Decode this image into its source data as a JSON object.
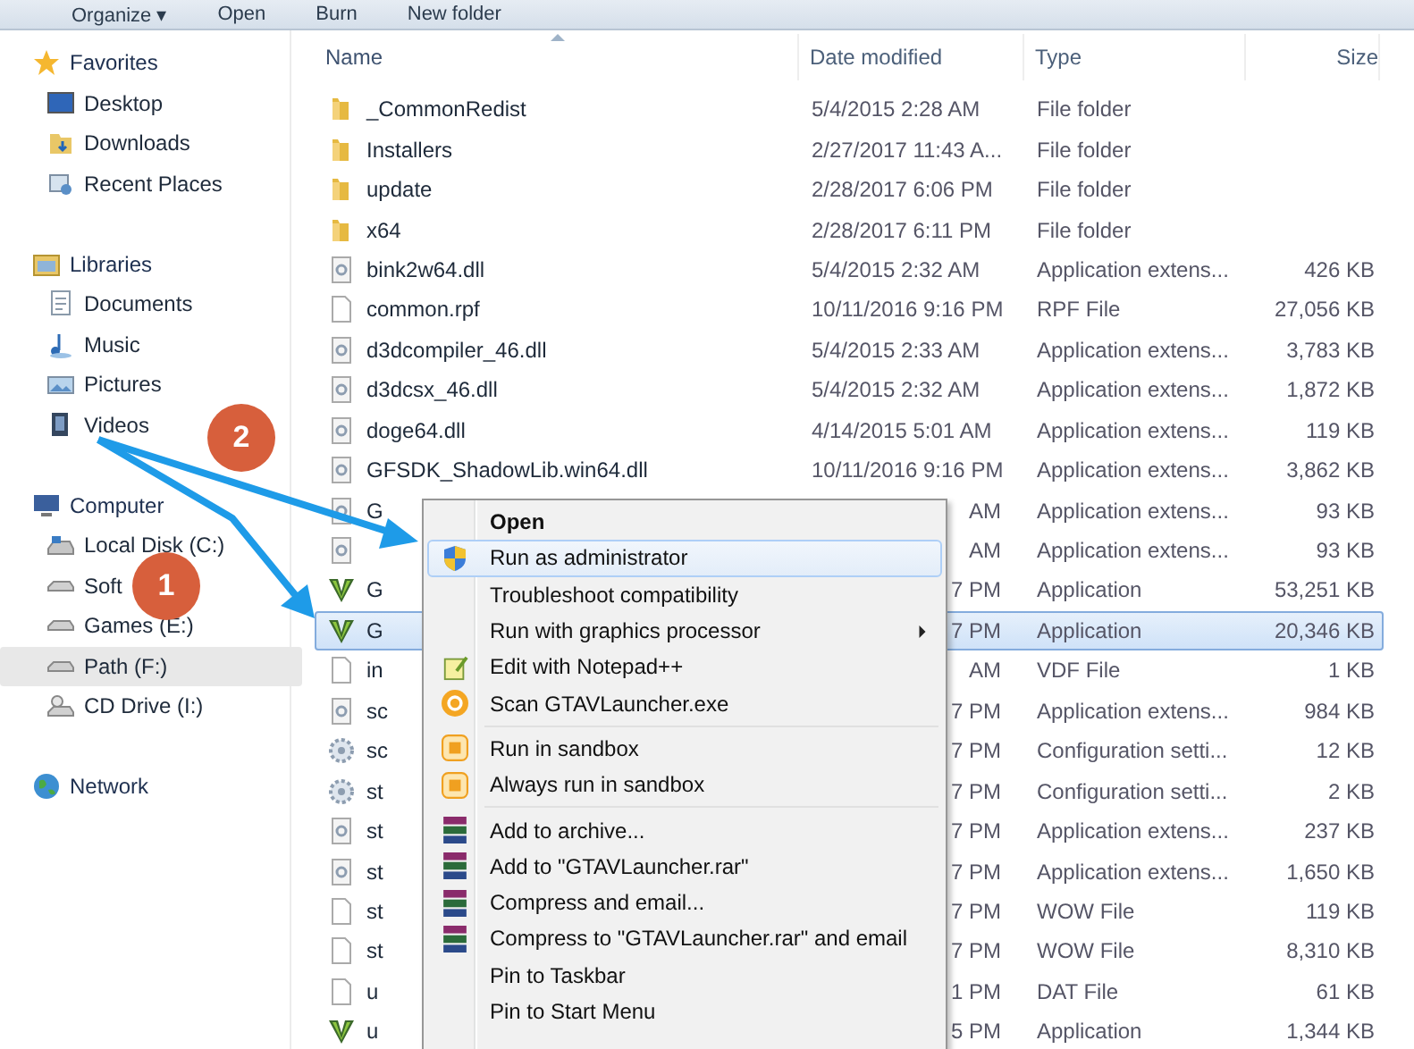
{
  "toolbar": {
    "buttons": [
      {
        "label": "Organize ▾"
      },
      {
        "label": "Open"
      },
      {
        "label": "Burn"
      },
      {
        "label": "New folder"
      }
    ]
  },
  "sidebar": {
    "groups": [
      {
        "label": "Favorites",
        "kind": "favorites",
        "items": [
          {
            "label": "Desktop",
            "kind": "desktop",
            "selected": false
          },
          {
            "label": "Downloads",
            "kind": "downloads",
            "selected": false
          },
          {
            "label": "Recent Places",
            "kind": "recent",
            "selected": false
          }
        ]
      },
      {
        "label": "Libraries",
        "kind": "libraries",
        "items": [
          {
            "label": "Documents",
            "kind": "documents",
            "selected": false
          },
          {
            "label": "Music",
            "kind": "music",
            "selected": false
          },
          {
            "label": "Pictures",
            "kind": "pictures",
            "selected": false
          },
          {
            "label": "Videos",
            "kind": "videos",
            "selected": false
          }
        ]
      },
      {
        "label": "Computer",
        "kind": "computer",
        "items": [
          {
            "label": "Local Disk (C:)",
            "kind": "disk",
            "selected": false
          },
          {
            "label": "Soft",
            "kind": "drive",
            "selected": false
          },
          {
            "label": "Games (E:)",
            "kind": "drive",
            "selected": false
          },
          {
            "label": "Path (F:)",
            "kind": "drive",
            "selected": true
          },
          {
            "label": "CD Drive (I:)",
            "kind": "cd",
            "selected": false
          }
        ]
      },
      {
        "label": "Network",
        "kind": "network"
      }
    ]
  },
  "table": {
    "columns": [
      {
        "label": "Name",
        "sorted": true
      },
      {
        "label": "Date modified",
        "sorted": false
      },
      {
        "label": "Type",
        "sorted": false
      },
      {
        "label": "Size",
        "sorted": false
      }
    ],
    "rows": [
      {
        "kind": "folder",
        "name": "_CommonRedist",
        "date": "5/4/2015 2:28 AM",
        "type": "File folder",
        "selected": false
      },
      {
        "kind": "folder",
        "name": "Installers",
        "date": "2/27/2017 11:43 A...",
        "type": "File folder",
        "selected": false
      },
      {
        "kind": "folder",
        "name": "update",
        "date": "2/28/2017 6:06 PM",
        "type": "File folder",
        "selected": false
      },
      {
        "kind": "folder",
        "name": "x64",
        "date": "2/28/2017 6:11 PM",
        "type": "File folder",
        "selected": false
      },
      {
        "kind": "dll",
        "name": "bink2w64.dll",
        "date": "5/4/2015 2:32 AM",
        "type": "Application extens...",
        "size": "426 KB",
        "selected": false
      },
      {
        "kind": "file",
        "name": "common.rpf",
        "date": "10/11/2016 9:16 PM",
        "type": "RPF File",
        "size": "27,056 KB",
        "selected": false
      },
      {
        "kind": "dll",
        "name": "d3dcompiler_46.dll",
        "date": "5/4/2015 2:33 AM",
        "type": "Application extens...",
        "size": "3,783 KB",
        "selected": false
      },
      {
        "kind": "dll",
        "name": "d3dcsx_46.dll",
        "date": "5/4/2015 2:32 AM",
        "type": "Application extens...",
        "size": "1,872 KB",
        "selected": false
      },
      {
        "kind": "dll",
        "name": "doge64.dll",
        "date": "4/14/2015 5:01 AM",
        "type": "Application extens...",
        "size": "119 KB",
        "selected": false
      },
      {
        "kind": "dll",
        "name": "GFSDK_ShadowLib.win64.dll",
        "date": "10/11/2016 9:16 PM",
        "type": "Application extens...",
        "size": "3,862 KB",
        "selected": false
      },
      {
        "kind": "dll",
        "name": "G",
        "date_end": "AM",
        "type": "Application extens...",
        "size": "93 KB",
        "selected": false
      },
      {
        "kind": "dll",
        "date_end": "AM",
        "type": "Application extens...",
        "size": "93 KB",
        "selected": false
      },
      {
        "kind": "app",
        "name": "G",
        "date_end": "7 PM",
        "type": "Application",
        "size": "53,251 KB",
        "selected": false
      },
      {
        "kind": "app",
        "name": "G",
        "date_end": "7 PM",
        "type": "Application",
        "size": "20,346 KB",
        "selected": true
      },
      {
        "kind": "file",
        "name": "in",
        "date_end": "AM",
        "type": "VDF File",
        "size": "1 KB",
        "selected": false
      },
      {
        "kind": "dll",
        "name": "sc",
        "date_end": "7 PM",
        "type": "Application extens...",
        "size": "984 KB",
        "selected": false
      },
      {
        "kind": "config",
        "name": "sc",
        "date_end": "7 PM",
        "type": "Configuration setti...",
        "size": "12 KB",
        "selected": false
      },
      {
        "kind": "config",
        "name": "st",
        "date_end": "7 PM",
        "type": "Configuration setti...",
        "size": "2 KB",
        "selected": false
      },
      {
        "kind": "dll",
        "name": "st",
        "date_end": "7 PM",
        "type": "Application extens...",
        "size": "237 KB",
        "selected": false
      },
      {
        "kind": "dll",
        "name": "st",
        "date_end": "7 PM",
        "type": "Application extens...",
        "size": "1,650 KB",
        "selected": false
      },
      {
        "kind": "file",
        "name": "st",
        "date_end": "7 PM",
        "type": "WOW File",
        "size": "119 KB",
        "selected": false
      },
      {
        "kind": "file",
        "name": "st",
        "date_end": "7 PM",
        "type": "WOW File",
        "size": "8,310 KB",
        "selected": false
      },
      {
        "kind": "file",
        "name": "u",
        "date_end": "1 PM",
        "type": "DAT File",
        "size": "61 KB",
        "selected": false
      },
      {
        "kind": "app",
        "name": "u",
        "date_end": "5 PM",
        "type": "Application",
        "size": "1,344 KB",
        "selected": false
      }
    ]
  },
  "context_menu": {
    "items": [
      {
        "kind": "plain",
        "label": "Open",
        "bold": true,
        "selected": false
      },
      {
        "kind": "shield",
        "label": "Run as administrator",
        "selected": true
      },
      {
        "kind": "plain",
        "label": "Troubleshoot compatibility",
        "selected": false
      },
      {
        "kind": "plain",
        "label": "Run with graphics processor",
        "submenu": true,
        "selected": false
      },
      {
        "kind": "notepad",
        "label": "Edit with Notepad++",
        "selected": false
      },
      {
        "kind": "scan",
        "label": "Scan GTAVLauncher.exe",
        "selected": false
      },
      {
        "kind": "separator"
      },
      {
        "kind": "sandbox",
        "label": "Run in sandbox",
        "selected": false
      },
      {
        "kind": "sandbox",
        "label": "Always run in sandbox",
        "selected": false
      },
      {
        "kind": "separator"
      },
      {
        "kind": "archive",
        "label": "Add to archive...",
        "selected": false
      },
      {
        "kind": "archive",
        "label": "Add to \"GTAVLauncher.rar\"",
        "selected": false
      },
      {
        "kind": "archive",
        "label": "Compress and email...",
        "selected": false
      },
      {
        "kind": "archive",
        "label": "Compress to \"GTAVLauncher.rar\" and email",
        "selected": false
      },
      {
        "kind": "plain",
        "label": "Pin to Taskbar",
        "selected": false
      },
      {
        "kind": "plain",
        "label": "Pin to Start Menu",
        "selected": false
      }
    ]
  },
  "callouts": [
    {
      "label": "1"
    },
    {
      "label": "2"
    }
  ]
}
